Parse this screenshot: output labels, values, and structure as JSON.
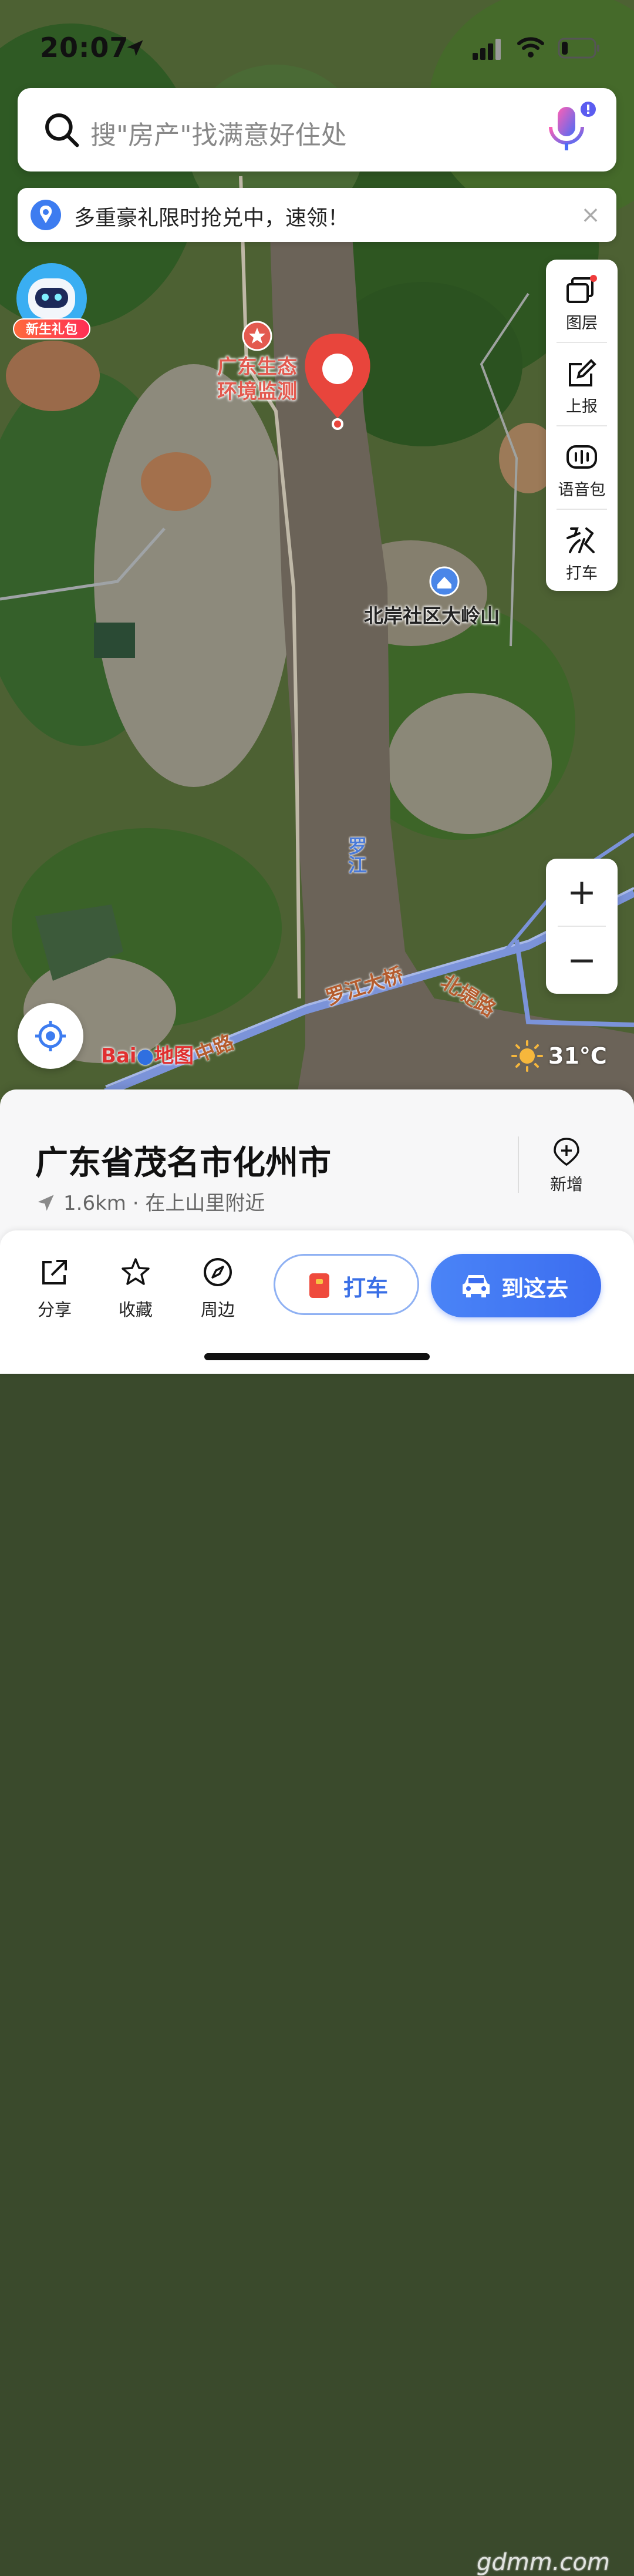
{
  "status_bar": {
    "time": "20:07"
  },
  "search": {
    "placeholder": "搜\"房产\"找满意好住处"
  },
  "promo": {
    "text": "多重豪礼限时抢兑中，速领！"
  },
  "gift": {
    "label": "新生礼包"
  },
  "tools": [
    {
      "label": "图层",
      "icon": "layers-icon"
    },
    {
      "label": "上报",
      "icon": "report-icon"
    },
    {
      "label": "语音包",
      "icon": "voice-pack-icon"
    },
    {
      "label": "打车",
      "icon": "taxi-icon"
    }
  ],
  "map": {
    "poi_red": "广东生态\n环境监测",
    "poi_community": "北岸社区大岭山",
    "river": "罗江",
    "bridge": "罗江大桥",
    "road_north": "北堤路",
    "road_middle": "中路",
    "logo_bai": "Bai",
    "logo_map": "地图"
  },
  "weather": {
    "temp": "31°C"
  },
  "place": {
    "title": "广东省茂名市化州市",
    "distance": "1.6km",
    "separator": "·",
    "nearby": "在上山里附近",
    "add_label": "新增"
  },
  "actions": {
    "share": "分享",
    "favorite": "收藏",
    "nearby": "周边",
    "taxi": "打车",
    "go": "到这去"
  },
  "watermark": "gdmm.com",
  "colors": {
    "accent": "#3c6df0",
    "marker": "#e8453c",
    "river": "#6b6358"
  }
}
